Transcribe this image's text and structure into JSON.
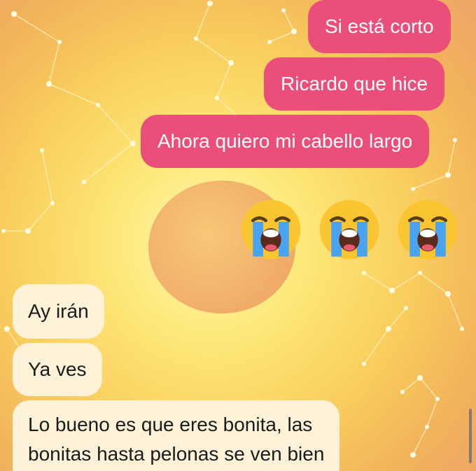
{
  "chat": {
    "outgoing": [
      "Si está corto",
      "Ricardo que hice",
      "Ahora quiero mi cabello largo"
    ],
    "emoji_row": [
      "loudly-crying-face",
      "loudly-crying-face",
      "loudly-crying-face"
    ],
    "incoming": [
      "Ay irán",
      "Ya ves",
      "Lo bueno es que eres bonita, las",
      "bonitas hasta pelonas se ven bien"
    ]
  },
  "colors": {
    "outgoing_bubble": "#eb4f79",
    "incoming_bubble": "#fdf2d8"
  }
}
